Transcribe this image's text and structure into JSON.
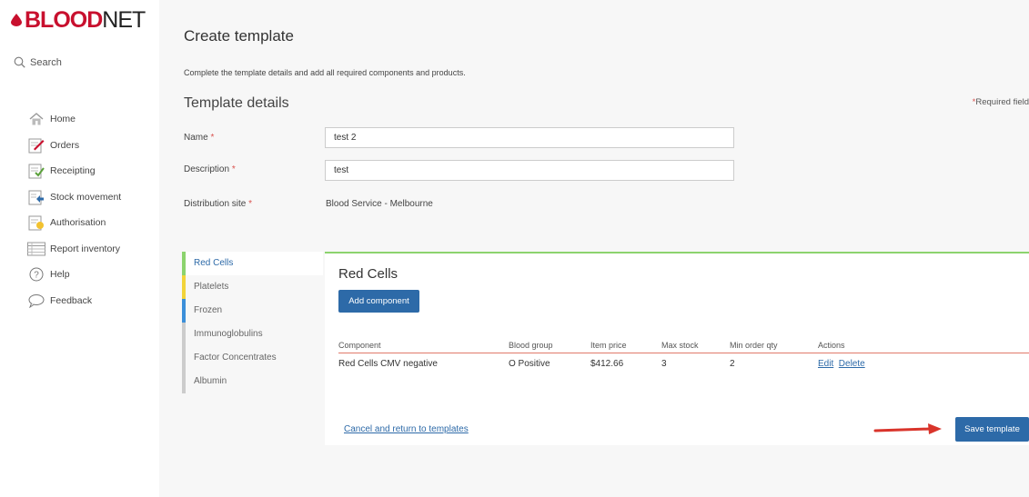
{
  "brand": {
    "logo_left": "BLOOD",
    "logo_right": "NET",
    "accent": "#c8102e"
  },
  "search": {
    "label": "Search"
  },
  "nav": {
    "items": [
      {
        "label": "Home",
        "icon": "home-icon"
      },
      {
        "label": "Orders",
        "icon": "orders-icon"
      },
      {
        "label": "Receipting",
        "icon": "receipting-icon"
      },
      {
        "label": "Stock movement",
        "icon": "stock-movement-icon"
      },
      {
        "label": "Authorisation",
        "icon": "authorisation-icon"
      },
      {
        "label": "Report inventory",
        "icon": "report-inventory-icon"
      },
      {
        "label": "Help",
        "icon": "help-icon"
      },
      {
        "label": "Feedback",
        "icon": "feedback-icon"
      }
    ]
  },
  "page": {
    "title": "Create template",
    "intro": "Complete the template details and add all required components and products.",
    "section_title": "Template details",
    "required_note": "Required field"
  },
  "form": {
    "name_label": "Name",
    "name_value": "test 2",
    "description_label": "Description",
    "description_value": "test",
    "site_label": "Distribution site",
    "site_value": "Blood Service - Melbourne",
    "required_marker": "*"
  },
  "categories": [
    {
      "label": "Red Cells",
      "color": "#8cd36e",
      "active": true
    },
    {
      "label": "Platelets",
      "color": "#f2d43a",
      "active": false
    },
    {
      "label": "Frozen",
      "color": "#3b8fd9",
      "active": false
    },
    {
      "label": "Immunoglobulins",
      "color": "#cccccc",
      "active": false
    },
    {
      "label": "Factor Concentrates",
      "color": "#cccccc",
      "active": false
    },
    {
      "label": "Albumin",
      "color": "#cccccc",
      "active": false
    }
  ],
  "panel": {
    "title": "Red Cells",
    "add_button": "Add component",
    "columns": [
      "Component",
      "Blood group",
      "Item price",
      "Max stock",
      "Min order qty",
      "Actions"
    ],
    "rows": [
      {
        "component": "Red Cells CMV negative",
        "blood_group": "O Positive",
        "price": "$412.66",
        "max_stock": "3",
        "min_order": "2",
        "edit": "Edit",
        "delete": "Delete"
      }
    ],
    "cancel_link": "Cancel and return to templates",
    "save_button": "Save template"
  },
  "colors": {
    "primary": "#2d6aa8",
    "required": "#d9534f",
    "arrow": "#d9342b"
  }
}
